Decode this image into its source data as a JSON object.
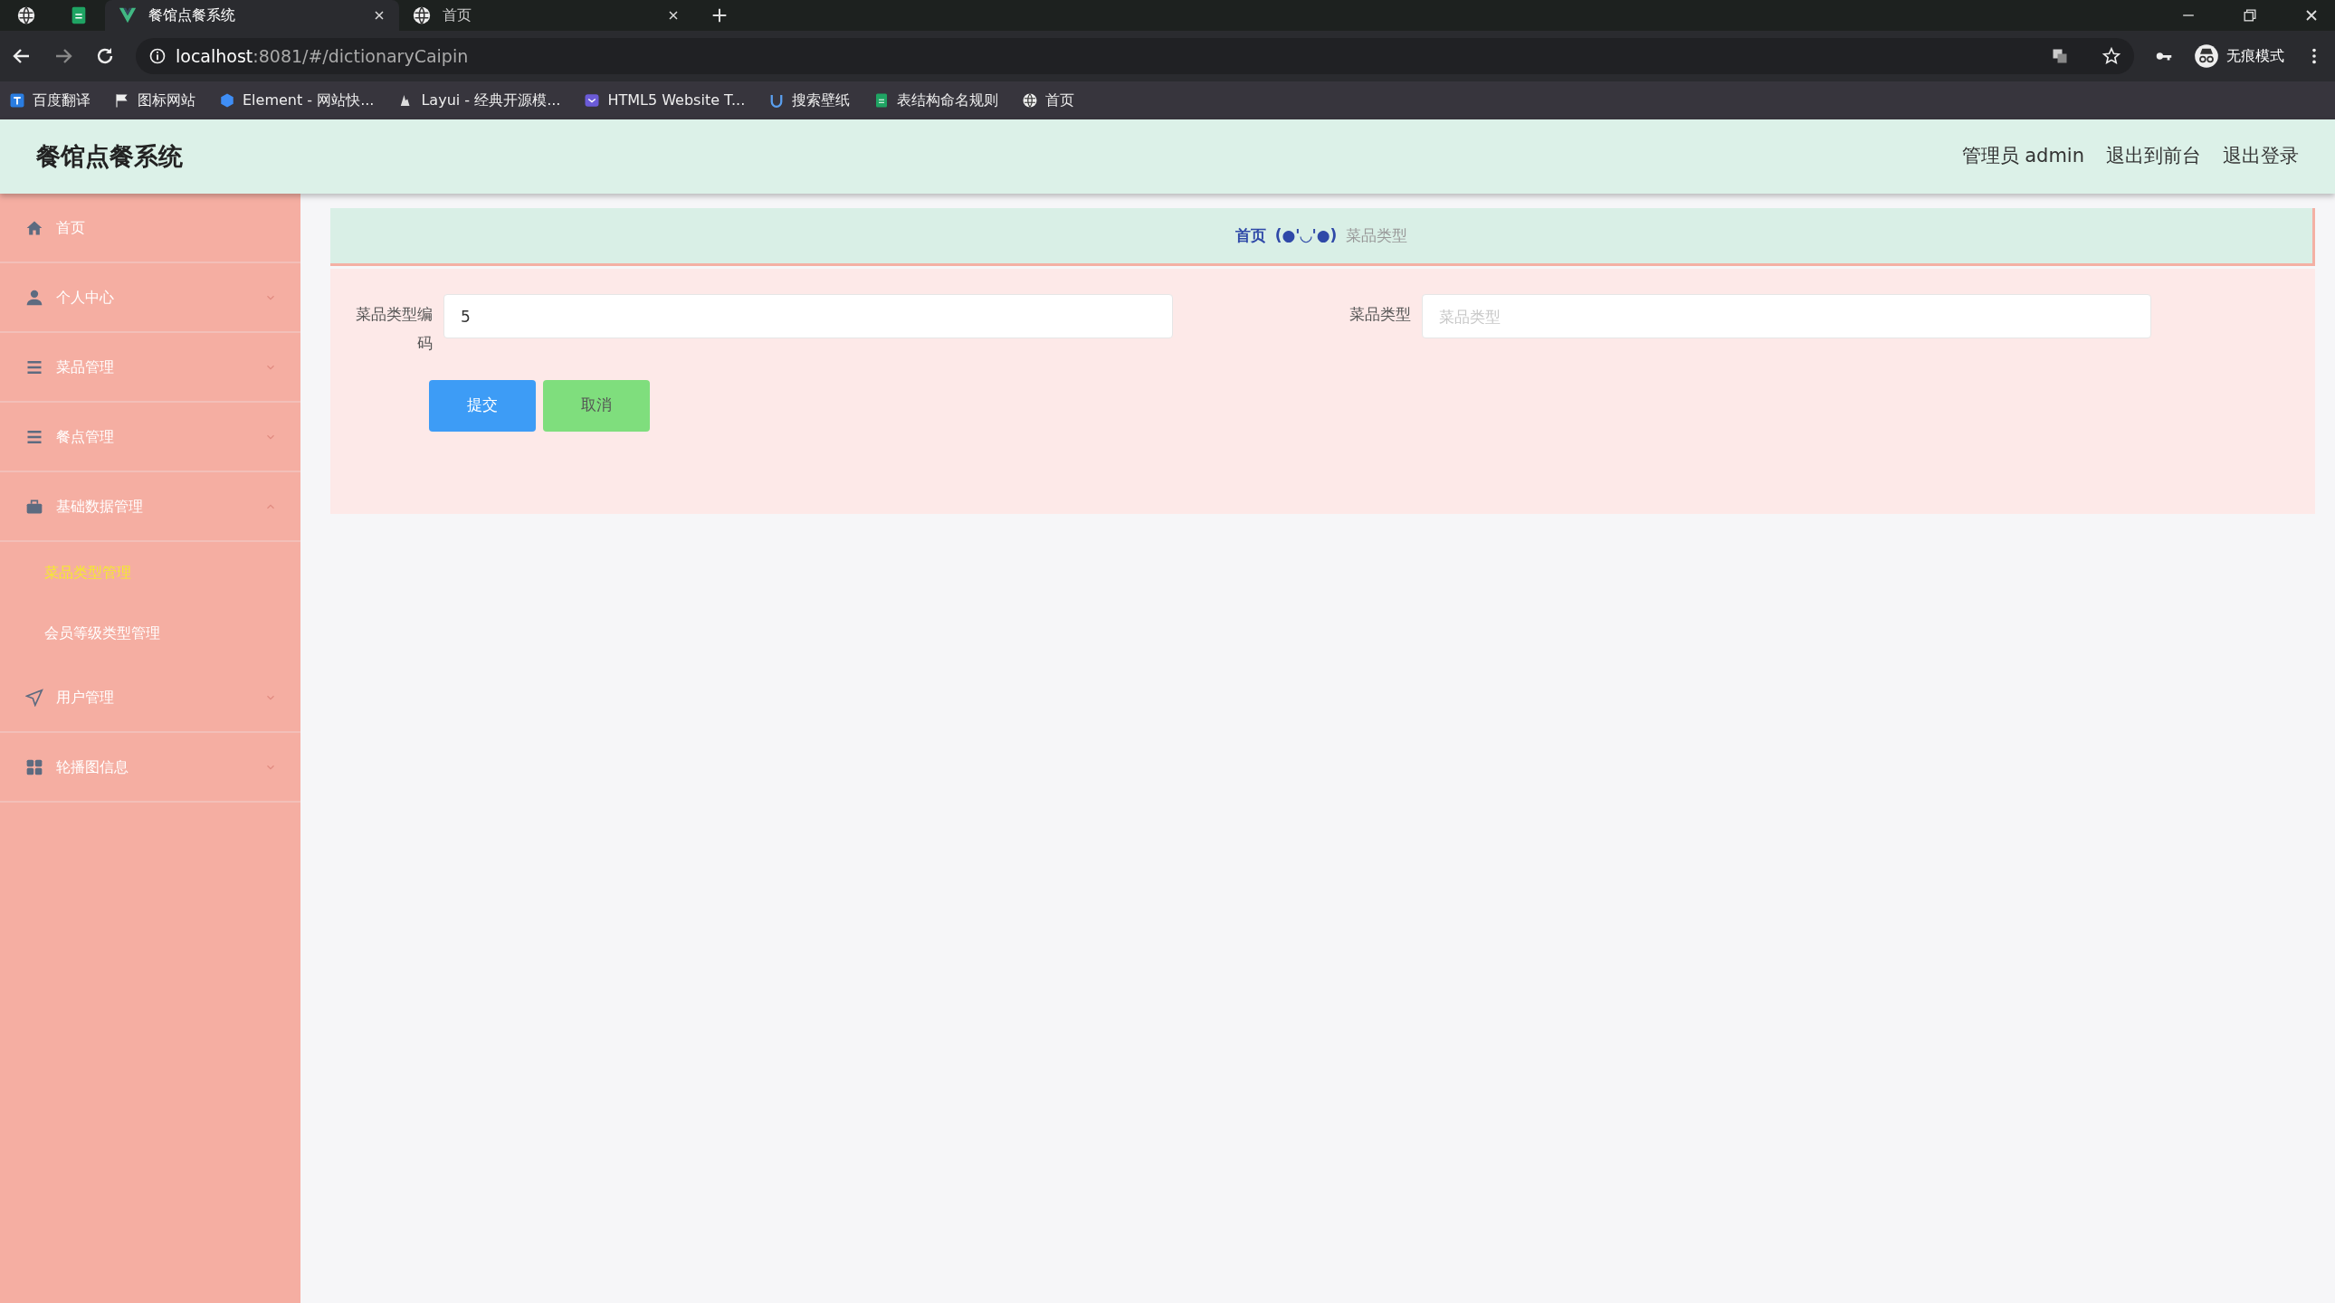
{
  "browser": {
    "tabs": [
      {
        "title": "餐馆点餐系统",
        "selected": true
      },
      {
        "title": "首页",
        "selected": false
      }
    ],
    "url_host": "localhost",
    "url_rest": ":8081/#/dictionaryCaipin",
    "bookmarks": [
      "百度翻译",
      "图标网站",
      "Element - 网站快...",
      "Layui - 经典开源模...",
      "HTML5 Website T...",
      "搜索壁纸",
      "表结构命名规则",
      "首页"
    ],
    "profile": "无痕模式"
  },
  "header": {
    "title": "餐馆点餐系统",
    "links": [
      "管理员 admin",
      "退出到前台",
      "退出登录"
    ]
  },
  "sidebar": {
    "items": [
      {
        "label": "首页"
      },
      {
        "label": "个人中心",
        "expanded": false
      },
      {
        "label": "菜品管理",
        "expanded": false
      },
      {
        "label": "餐点管理",
        "expanded": false
      },
      {
        "label": "基础数据管理",
        "expanded": true,
        "children": [
          {
            "label": "菜品类型管理",
            "selected": true
          },
          {
            "label": "会员等级类型管理",
            "selected": false
          }
        ]
      },
      {
        "label": "用户管理",
        "expanded": false
      },
      {
        "label": "轮播图信息",
        "expanded": false
      }
    ]
  },
  "breadcrumb": {
    "home": "首页",
    "separator": "(●'◡'●)",
    "current": "菜品类型"
  },
  "form": {
    "fields": [
      {
        "label": "菜品类型编码",
        "value": "5"
      },
      {
        "label": "菜品类型",
        "placeholder": "菜品类型"
      }
    ],
    "buttons": [
      {
        "label": "提交",
        "kind": "primary"
      },
      {
        "label": "取消",
        "kind": "cancel"
      }
    ]
  }
}
